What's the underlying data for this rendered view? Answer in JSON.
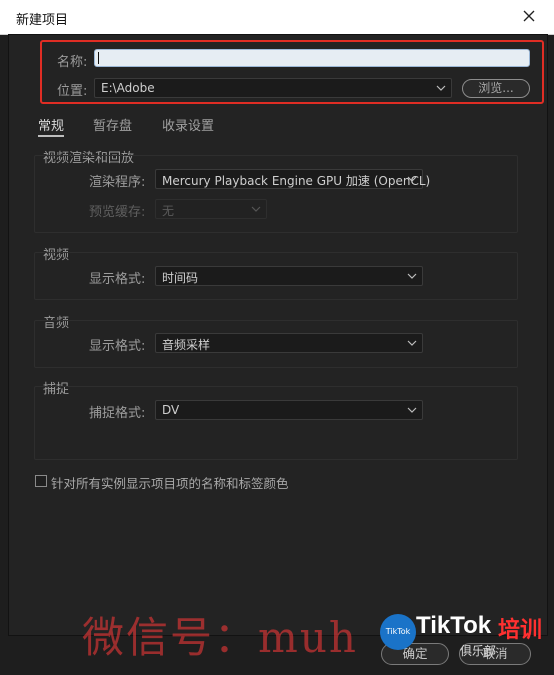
{
  "window": {
    "title": "新建项目"
  },
  "form": {
    "name_label": "名称:",
    "name_value": "",
    "location_label": "位置:",
    "location_value": "E:\\Adobe",
    "browse_label": "浏览..."
  },
  "tabs": [
    {
      "label": "常规",
      "active": true
    },
    {
      "label": "暂存盘",
      "active": false
    },
    {
      "label": "收录设置",
      "active": false
    }
  ],
  "sections": {
    "render": {
      "title": "视频渲染和回放",
      "renderer_label": "渲染程序:",
      "renderer_value": "Mercury Playback Engine GPU 加速 (OpenCL)",
      "preview_cache_label": "预览缓存:",
      "preview_cache_value": "无"
    },
    "video": {
      "title": "视频",
      "display_format_label": "显示格式:",
      "display_format_value": "时间码"
    },
    "audio": {
      "title": "音频",
      "display_format_label": "显示格式:",
      "display_format_value": "音频采样"
    },
    "capture": {
      "title": "捕捉",
      "capture_format_label": "捕捉格式:",
      "capture_format_value": "DV"
    }
  },
  "checkbox": {
    "label": "针对所有实例显示项目项的名称和标签颜色",
    "checked": false
  },
  "buttons": {
    "ok": "确定",
    "cancel": "取消"
  },
  "watermark": {
    "text": "微信号：muh",
    "logo_badge": "TikTok",
    "logo_text": "TikTok",
    "logo_red": "培训",
    "logo_sub": "俱乐部"
  },
  "colors": {
    "highlight_border": "#e02d24",
    "input_bg": "#e6edf3",
    "panel_bg": "#232323"
  }
}
